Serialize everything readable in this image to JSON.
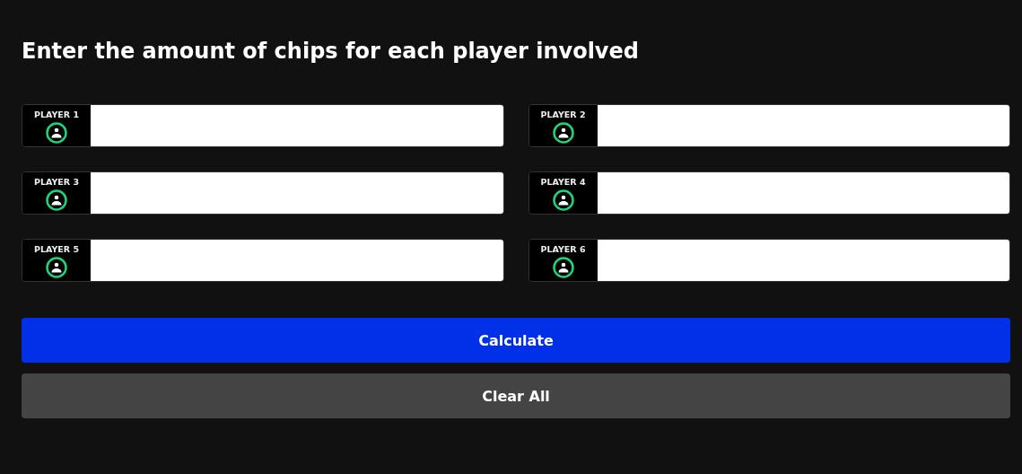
{
  "heading": "Enter the amount of chips for each player involved",
  "players": [
    {
      "label": "PLAYER 1"
    },
    {
      "label": "PLAYER 2"
    },
    {
      "label": "PLAYER 3"
    },
    {
      "label": "PLAYER 4"
    },
    {
      "label": "PLAYER 5"
    },
    {
      "label": "PLAYER 6"
    }
  ],
  "buttons": [
    {
      "label": "Calculate",
      "kind": "primary"
    },
    {
      "label": "Clear All",
      "kind": "secondary"
    }
  ]
}
